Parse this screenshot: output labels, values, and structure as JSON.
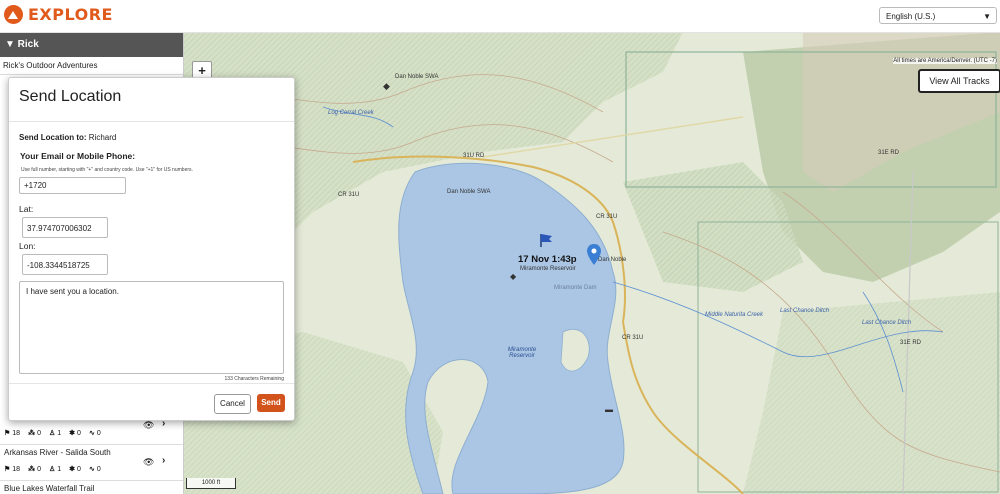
{
  "app": {
    "logo_text": "EXPLORE"
  },
  "header": {
    "language": "English (U.S.)"
  },
  "sidebar": {
    "user": "▼ Rick",
    "company": "Rick's Outdoor Adventures",
    "tracks": [
      {
        "name": "Arkansas River - Salida South",
        "stats": [
          "18",
          "0",
          "1",
          "0",
          "0"
        ]
      },
      {
        "name": "Blue Lakes Waterfall Trail"
      }
    ],
    "upper_stats": [
      "18",
      "0",
      "1",
      "0",
      "0"
    ]
  },
  "map": {
    "timezone_note": "All times are America/Denver. (UTC -7)",
    "view_all_tracks": "View All Tracks",
    "zoom_in": "+",
    "scale": "1000 ft",
    "labels": {
      "dan_noble_swa_top": "Dan Noble SWA",
      "log_corral_creek": "Log Corral Creek",
      "road_31u": "31U RD",
      "cr_31u": "CR 31U",
      "dan_noble_swa": "Dan Noble SWA",
      "cr_31u_b": "CR 31U",
      "dan_noble": "Dan Noble",
      "marker_time": "17 Nov 1:43p",
      "miramonte_reservoir_pt": "Miramonte Reservoir",
      "miramonte_dam": "Miramonte Dam",
      "miramonte_reservoir": "Miramonte Reservoir",
      "cr_31u_c": "CR 31U",
      "middle_naturita_creek": "Middle Naturita Creek",
      "last_chance_ditch": "Last Chance Ditch",
      "last_chance_ditch_b": "Last Chance Ditch",
      "rd_31e": "31E RD",
      "rd_31e_b": "31E RD"
    }
  },
  "modal": {
    "title": "Send Location",
    "to_label": "Send Location to:",
    "to_name": "Richard",
    "email_label": "Your Email or Mobile Phone:",
    "help": "Use full number, starting with \"+\" and country code. Use \"+1\" for US numbers.",
    "phone_value": "+1720",
    "lat_label": "Lat:",
    "lat_value": "37.974707006302",
    "lon_label": "Lon:",
    "lon_value": "-108.3344518725",
    "message": "I have sent you a location.",
    "remaining": "133 Characters Remaining",
    "cancel": "Cancel",
    "send": "Send"
  },
  "colors": {
    "brand": "#e05a1c",
    "water": "#aac6e4",
    "land": "#dfe9d5",
    "send": "#d2531c"
  }
}
